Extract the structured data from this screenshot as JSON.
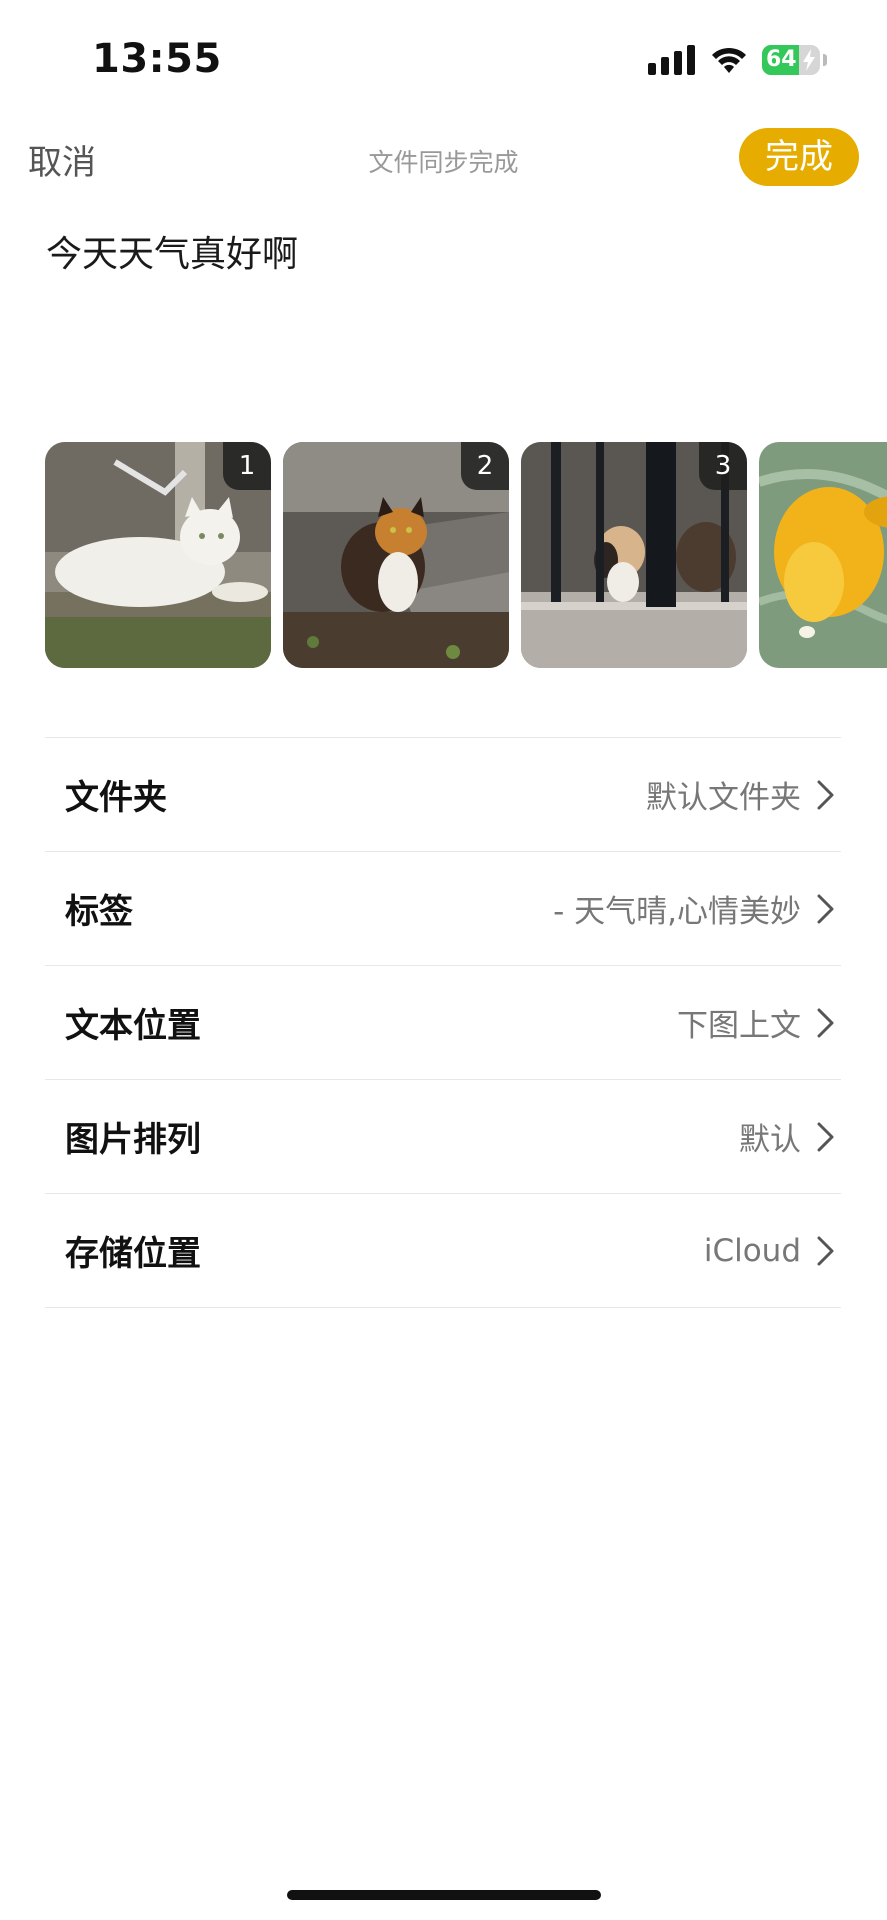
{
  "status_bar": {
    "time": "13:55",
    "battery_level": "64",
    "icons": [
      "cellular-signal-icon",
      "wifi-icon",
      "battery-charging-icon"
    ]
  },
  "nav": {
    "cancel_label": "取消",
    "title": "文件同步完成",
    "done_label": "完成"
  },
  "note": {
    "text": "今天天气真好啊"
  },
  "images": [
    {
      "index": "1",
      "subject": "white cat lying on stone ledge"
    },
    {
      "index": "2",
      "subject": "calico cat standing on steps"
    },
    {
      "index": "3",
      "subject": "calico cat behind fence"
    },
    {
      "index": "",
      "subject": "yellow koi fish in water (partially visible)"
    }
  ],
  "settings": [
    {
      "label": "文件夹",
      "value": "默认文件夹"
    },
    {
      "label": "标签",
      "value": "- 天气晴,心情美妙"
    },
    {
      "label": "文本位置",
      "value": "下图上文"
    },
    {
      "label": "图片排列",
      "value": "默认"
    },
    {
      "label": "存储位置",
      "value": "iCloud"
    }
  ],
  "colors": {
    "accent": "#e6ac00",
    "battery_green": "#34c759",
    "secondary_text": "#777777",
    "divider": "#e8e8e8"
  }
}
